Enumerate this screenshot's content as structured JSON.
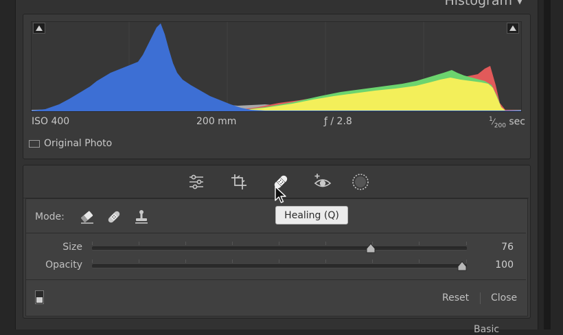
{
  "histogram": {
    "title": "Histogram",
    "collapse_icon": "triangle-down-icon",
    "iso": "ISO 400",
    "focal_length": "200 mm",
    "aperture": "ƒ / 2.8",
    "shutter_numerator": "1",
    "shutter_denominator": "200",
    "shutter_unit": "sec",
    "original_photo_label": "Original Photo",
    "colors": {
      "blue": "#3d6fd4",
      "yellow": "#f3ef5a",
      "green": "#6cd46e",
      "red": "#e25a5a",
      "gray": "#a9a9a9"
    }
  },
  "tool_strip": {
    "tools": [
      {
        "name": "edit-sliders-icon"
      },
      {
        "name": "crop-icon"
      },
      {
        "name": "healing-icon",
        "active": true
      },
      {
        "name": "red-eye-icon"
      },
      {
        "name": "masking-icon"
      }
    ],
    "tooltip": "Healing (Q)"
  },
  "healing_panel": {
    "mode_label": "Mode:",
    "modes": [
      "content-aware-remove-icon",
      "heal-icon",
      "clone-icon"
    ],
    "size_label": "Size",
    "size_value": "76",
    "size_fraction": 0.75,
    "opacity_label": "Opacity",
    "opacity_value": "100",
    "opacity_fraction": 1.0,
    "reset_label": "Reset",
    "close_label": "Close"
  },
  "next_panel_title": "Basic"
}
